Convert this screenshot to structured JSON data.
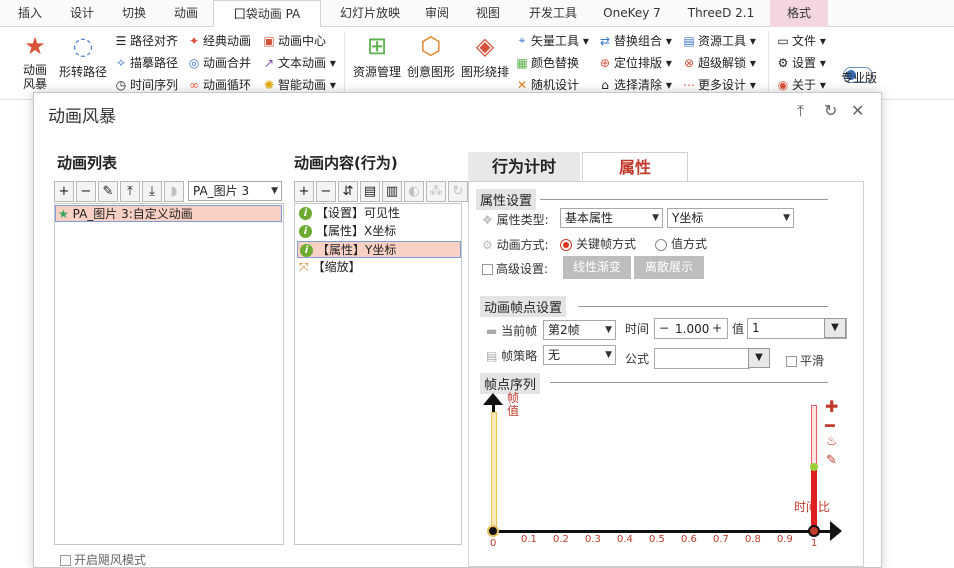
{
  "tabs": [
    {
      "label": "插入"
    },
    {
      "label": "设计"
    },
    {
      "label": "切换"
    },
    {
      "label": "动画"
    },
    {
      "label": "囗袋动画 PA"
    },
    {
      "label": "幻灯片放映"
    },
    {
      "label": "审阅"
    },
    {
      "label": "视图"
    },
    {
      "label": "开发工具"
    },
    {
      "label": "OneKey 7"
    },
    {
      "label": "ThreeD 2.1"
    },
    {
      "label": "格式"
    }
  ],
  "ribbon": {
    "big": [
      {
        "label": "动画\n风暴"
      },
      {
        "label": "形转路径"
      },
      {
        "label": "资源管理"
      },
      {
        "label": "创意图形"
      },
      {
        "label": "图形绕排"
      },
      {
        "label": "专业版"
      }
    ],
    "col1": [
      "路径对齐",
      "描摹路径",
      "时间序列"
    ],
    "col2": [
      "经典动画",
      "动画合并",
      "动画循环"
    ],
    "col3": [
      "动画中心",
      "文本动画 ▾",
      "智能动画 ▾"
    ],
    "col4": [
      "矢量工具 ▾",
      "颜色替换",
      "随机设计"
    ],
    "col5": [
      "替换组合 ▾",
      "定位排版 ▾",
      "选择清除 ▾"
    ],
    "col6": [
      "资源工具 ▾",
      "超级解锁 ▾",
      "更多设计 ▾"
    ],
    "col7": [
      "文件 ▾",
      "设置 ▾",
      "关于 ▾"
    ]
  },
  "dialog": {
    "title": "动画风暴",
    "anim_list": {
      "title": "动画列表",
      "dropdown": "PA_图片 3",
      "items": [
        "PA_图片 3:自定义动画"
      ],
      "storm_mode_label": "开启飓风模式"
    },
    "anim_content": {
      "title": "动画内容(行为)",
      "items": [
        "【设置】可见性",
        "【属性】X坐标",
        "【属性】Y坐标",
        "【缩放】"
      ]
    },
    "right": {
      "tab_timing": "行为计时",
      "tab_props": "属性",
      "prop_section": "属性设置",
      "prop_type_label": "属性类型:",
      "prop_type_value": "基本属性",
      "prop_target_value": "Y坐标",
      "anim_mode_label": "动画方式:",
      "mode_keyframe": "关键帧方式",
      "mode_value": "值方式",
      "advanced_label": "高级设置:",
      "btn_linear": "线性渐变",
      "btn_discrete": "离散展示",
      "keyframe_section": "动画帧点设置",
      "cur_frame_label": "当前帧",
      "cur_frame_value": "第2帧",
      "time_label": "时间",
      "time_value": "1.000",
      "value_label": "值",
      "value_value": "1",
      "strategy_label": "帧策略",
      "strategy_value": "无",
      "formula_label": "公式",
      "smooth_label": "平滑",
      "seq_section": "帧点序列",
      "y_axis_label": "帧\n值",
      "x_axis_label": "时间比",
      "x_ticks": [
        "0",
        "0.1",
        "0.2",
        "0.3",
        "0.4",
        "0.5",
        "0.6",
        "0.7",
        "0.8",
        "0.9",
        "1"
      ]
    }
  },
  "colors": {
    "accent": "#c0392b",
    "selection": "#f9d0c4",
    "frame_bar": "#e8c15a"
  }
}
